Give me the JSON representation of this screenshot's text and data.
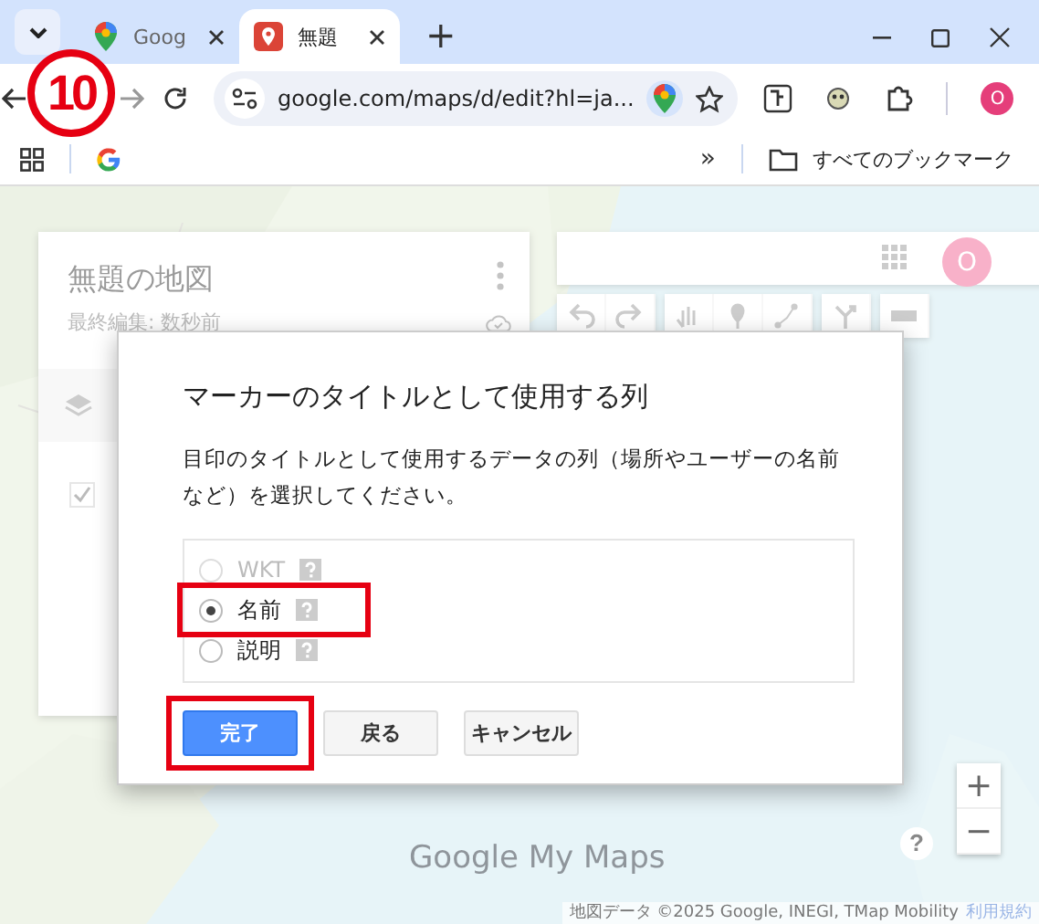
{
  "browser": {
    "tabs": [
      {
        "title": "Goog",
        "selected": false
      },
      {
        "title": "無題",
        "selected": true
      }
    ],
    "new_tab": "+",
    "url": "google.com/maps/d/edit?hl=ja...",
    "profile": "O",
    "bookmarks_overflow": "»",
    "bookmarks_folder": "すべてのブックマーク"
  },
  "step_badge": "10",
  "map_panel": {
    "title": "無題の地図",
    "subtitle": "最終編集: 数秒前",
    "layer_checked": true
  },
  "account": "O",
  "dialog": {
    "title": "マーカーのタイトルとして使用する列",
    "description": "目印のタイトルとして使用するデータの列（場所やユーザーの名前など）を選択してください。",
    "options": [
      {
        "label": "WKT",
        "selected": false,
        "disabled": true,
        "highlighted": false
      },
      {
        "label": "名前",
        "selected": true,
        "disabled": false,
        "highlighted": true
      },
      {
        "label": "説明",
        "selected": false,
        "disabled": false,
        "highlighted": false
      }
    ],
    "buttons": [
      {
        "label": "完了",
        "kind": "primary",
        "highlighted": true
      },
      {
        "label": "戻る",
        "kind": "secondary",
        "highlighted": false
      },
      {
        "label": "キャンセル",
        "kind": "secondary",
        "highlighted": false
      }
    ]
  },
  "map_controls": {
    "help": "?",
    "zoom_in": "+",
    "zoom_out": "−"
  },
  "logo": "Google My Maps",
  "attribution": "地図データ ©2025 Google, INEGI, TMap Mobility",
  "terms": "利用規約"
}
